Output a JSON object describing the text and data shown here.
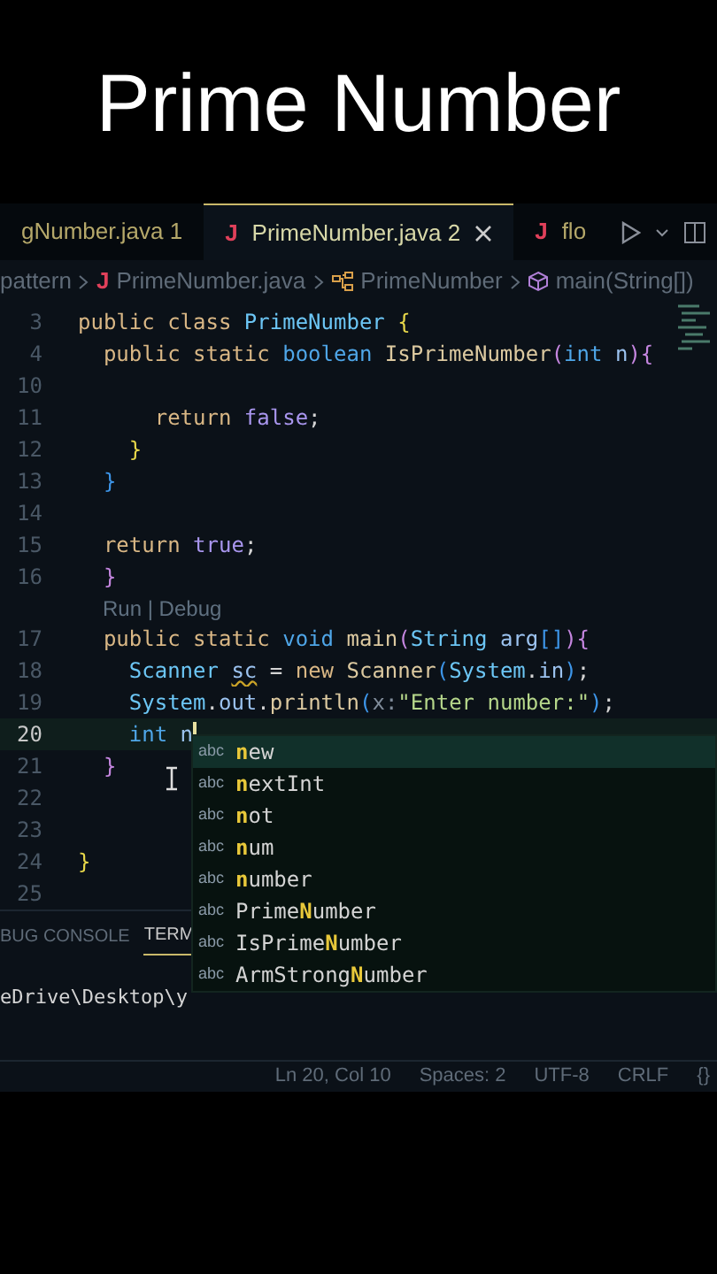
{
  "video_title": "Prime Number",
  "tabs": [
    {
      "label": "gNumber.java",
      "badge": "1",
      "selected": false,
      "closable": false
    },
    {
      "icon": "J",
      "label": "PrimeNumber.java",
      "badge": "2",
      "selected": true,
      "closable": true
    },
    {
      "icon": "J",
      "label": "flo",
      "selected": false,
      "closable": false
    }
  ],
  "breadcrumb": [
    {
      "kind": "folder",
      "text": "pattern"
    },
    {
      "kind": "file",
      "icon": "J",
      "text": "PrimeNumber.java"
    },
    {
      "kind": "class",
      "text": "PrimeNumber"
    },
    {
      "kind": "method",
      "text": "main(String[])"
    }
  ],
  "code_lines": [
    {
      "number": "3",
      "current": false,
      "cursor": false,
      "tokens": [
        {
          "kind": "keyword",
          "text": "public class "
        },
        {
          "kind": "class",
          "text": "PrimeNumber "
        },
        {
          "kind": "bracket1",
          "text": "{"
        }
      ]
    },
    {
      "number": "4",
      "current": false,
      "cursor": false,
      "tokens": [
        {
          "kind": "keyword",
          "text": "  public static "
        },
        {
          "kind": "type",
          "text": "boolean "
        },
        {
          "kind": "function",
          "text": "IsPrimeNumber"
        },
        {
          "kind": "bracket2",
          "text": "("
        },
        {
          "kind": "type",
          "text": "int "
        },
        {
          "kind": "variable",
          "text": "n"
        },
        {
          "kind": "bracket2",
          "text": "){"
        }
      ]
    },
    {
      "number": "10",
      "current": false,
      "cursor": false
    },
    {
      "number": "11",
      "current": false,
      "cursor": false,
      "tokens": [
        {
          "kind": "keyword",
          "text": "      return "
        },
        {
          "kind": "literal",
          "text": "false"
        },
        {
          "kind": "plain",
          "text": ";"
        }
      ]
    },
    {
      "number": "12",
      "current": false,
      "cursor": false,
      "tokens": [
        {
          "kind": "bracket1",
          "text": "    }"
        }
      ]
    },
    {
      "number": "13",
      "current": false,
      "cursor": false,
      "tokens": [
        {
          "kind": "bracket3",
          "text": "  }"
        }
      ]
    },
    {
      "number": "14",
      "current": false,
      "cursor": false
    },
    {
      "number": "15",
      "current": false,
      "cursor": false,
      "tokens": [
        {
          "kind": "keyword",
          "text": "  return "
        },
        {
          "kind": "literal",
          "text": "true"
        },
        {
          "kind": "plain",
          "text": ";"
        }
      ]
    },
    {
      "number": "16",
      "current": false,
      "cursor": false,
      "tokens": [
        {
          "kind": "bracket2",
          "text": "  }"
        }
      ]
    },
    {
      "number": "17",
      "lens": "Run | Debug",
      "current": false,
      "cursor": false,
      "tokens": [
        {
          "kind": "keyword",
          "text": "  public static "
        },
        {
          "kind": "type",
          "text": "void "
        },
        {
          "kind": "function",
          "text": "main"
        },
        {
          "kind": "bracket2",
          "text": "("
        },
        {
          "kind": "class",
          "text": "String "
        },
        {
          "kind": "variable",
          "text": "arg"
        },
        {
          "kind": "bracket3",
          "text": "[]"
        },
        {
          "kind": "bracket2",
          "text": "){"
        }
      ]
    },
    {
      "number": "18",
      "current": false,
      "cursor": false,
      "tokens": [
        {
          "kind": "class",
          "text": "    Scanner "
        },
        {
          "kind": "warning",
          "text": "sc"
        },
        {
          "kind": "plain",
          "text": " = "
        },
        {
          "kind": "keyword",
          "text": "new "
        },
        {
          "kind": "function",
          "text": "Scanner"
        },
        {
          "kind": "bracket3",
          "text": "("
        },
        {
          "kind": "class",
          "text": "System"
        },
        {
          "kind": "plain",
          "text": "."
        },
        {
          "kind": "variable",
          "text": "in"
        },
        {
          "kind": "bracket3",
          "text": ")"
        },
        {
          "kind": "plain",
          "text": ";"
        }
      ]
    },
    {
      "number": "19",
      "current": false,
      "cursor": false,
      "tokens": [
        {
          "kind": "class",
          "text": "    System"
        },
        {
          "kind": "plain",
          "text": "."
        },
        {
          "kind": "variable",
          "text": "out"
        },
        {
          "kind": "plain",
          "text": "."
        },
        {
          "kind": "function",
          "text": "println"
        },
        {
          "kind": "bracket3",
          "text": "("
        },
        {
          "kind": "hint",
          "text": "x:"
        },
        {
          "kind": "string",
          "text": "\"Enter number:\""
        },
        {
          "kind": "bracket3",
          "text": ")"
        },
        {
          "kind": "plain",
          "text": ";"
        }
      ]
    },
    {
      "number": "20",
      "current": true,
      "cursor": true,
      "tokens": [
        {
          "kind": "type",
          "text": "    int "
        },
        {
          "kind": "variable",
          "text": "n"
        }
      ]
    },
    {
      "number": "21",
      "current": false,
      "cursor": false,
      "tokens": [
        {
          "kind": "bracket2",
          "text": "  }"
        }
      ]
    },
    {
      "number": "22",
      "current": false,
      "cursor": false
    },
    {
      "number": "23",
      "current": false,
      "cursor": false
    },
    {
      "number": "24",
      "current": false,
      "cursor": false,
      "tokens": [
        {
          "kind": "bracket1",
          "text": "}"
        }
      ]
    },
    {
      "number": "25",
      "current": false,
      "cursor": false
    }
  ],
  "suggestions": [
    {
      "kind_label": "abc",
      "match": "n",
      "after": "ew",
      "selected": true
    },
    {
      "kind_label": "abc",
      "match": "n",
      "after": "extInt",
      "selected": false
    },
    {
      "kind_label": "abc",
      "match": "n",
      "after": "ot",
      "selected": false
    },
    {
      "kind_label": "abc",
      "match": "n",
      "after": "um",
      "selected": false
    },
    {
      "kind_label": "abc",
      "match": "n",
      "after": "umber",
      "selected": false
    },
    {
      "kind_label": "abc",
      "before": "Prime",
      "match": "N",
      "after": "umber",
      "selected": false
    },
    {
      "kind_label": "abc",
      "before": "IsPrime",
      "match": "N",
      "after": "umber",
      "selected": false
    },
    {
      "kind_label": "abc",
      "before": "ArmStrong",
      "match": "N",
      "after": "umber",
      "selected": false
    }
  ],
  "panel_tabs": [
    {
      "label": "BUG CONSOLE",
      "selected": false
    },
    {
      "label": "TERM",
      "selected": true
    }
  ],
  "terminal_line": "eDrive\\Desktop\\y",
  "status_bar": [
    "Ln 20, Col 10",
    "Spaces: 2",
    "UTF-8",
    "CRLF",
    "{}"
  ]
}
